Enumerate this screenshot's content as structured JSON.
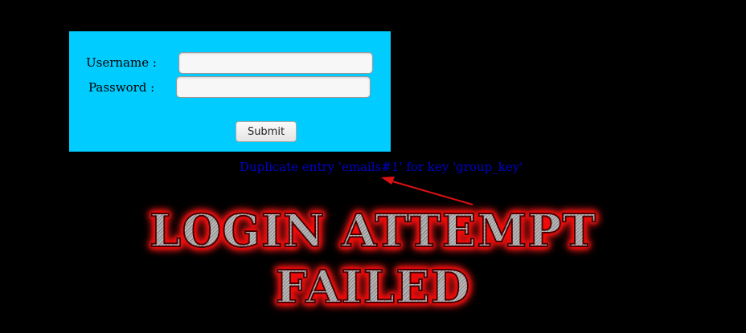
{
  "login_form": {
    "username_label": "Username :",
    "password_label": "Password :",
    "username_value": "",
    "password_value": "",
    "submit_label": "Submit",
    "panel_color": "#00ccff"
  },
  "error": {
    "message": "Duplicate entry 'emails#1' for key 'group_key'",
    "color": "#0000cc"
  },
  "annotation": {
    "arrow_color": "#dd1111"
  },
  "banner": {
    "line1": "LOGIN ATTEMPT",
    "line2": "FAILED",
    "glow_color": "#ff0000"
  }
}
